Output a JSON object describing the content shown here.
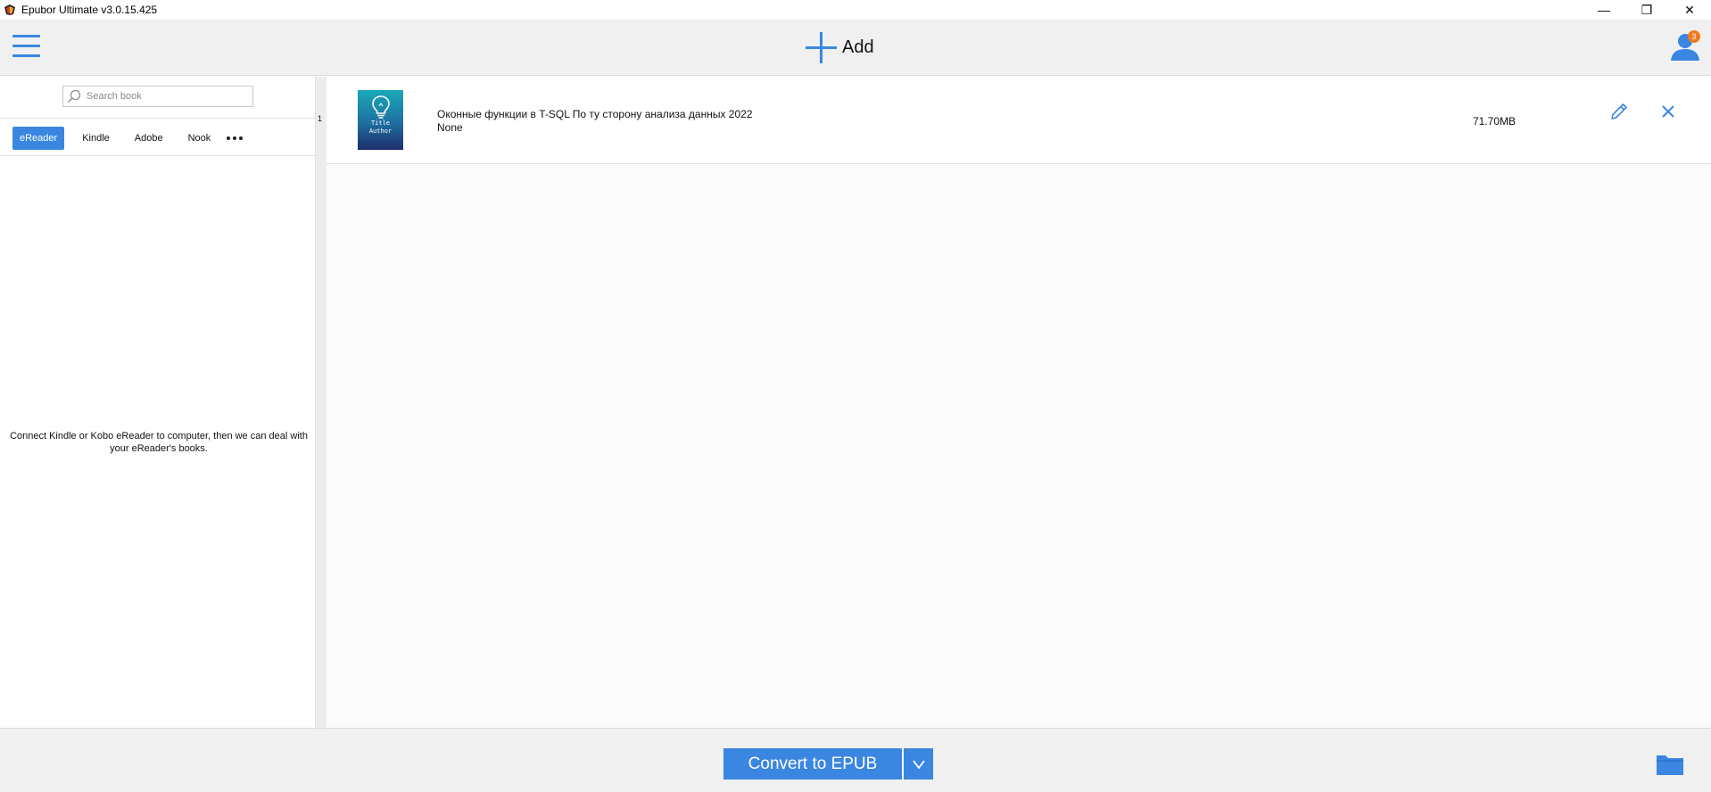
{
  "window": {
    "title": "Epubor Ultimate v3.0.15.425",
    "minimize": "—",
    "restore": "❐",
    "close": "✕"
  },
  "toolbar": {
    "add_label": "Add",
    "notification_count": "3"
  },
  "sidebar": {
    "search_placeholder": "Search book",
    "tabs": [
      {
        "label": "eReader",
        "active": true
      },
      {
        "label": "Kindle",
        "active": false
      },
      {
        "label": "Adobe",
        "active": false
      },
      {
        "label": "Nook",
        "active": false
      }
    ],
    "empty_message": "Connect Kindle or Kobo eReader to computer, then we can deal with your eReader's books."
  },
  "book_count": "1",
  "books": [
    {
      "cover_line1": "Title",
      "cover_line2": "Author",
      "title": "Оконные функции в T-SQL По ту сторону анализа данных 2022",
      "author": "None",
      "size": "71.70MB"
    }
  ],
  "footer": {
    "convert_label": "Convert to EPUB"
  },
  "colors": {
    "accent": "#3a86e0",
    "badge": "#f07a1d"
  }
}
